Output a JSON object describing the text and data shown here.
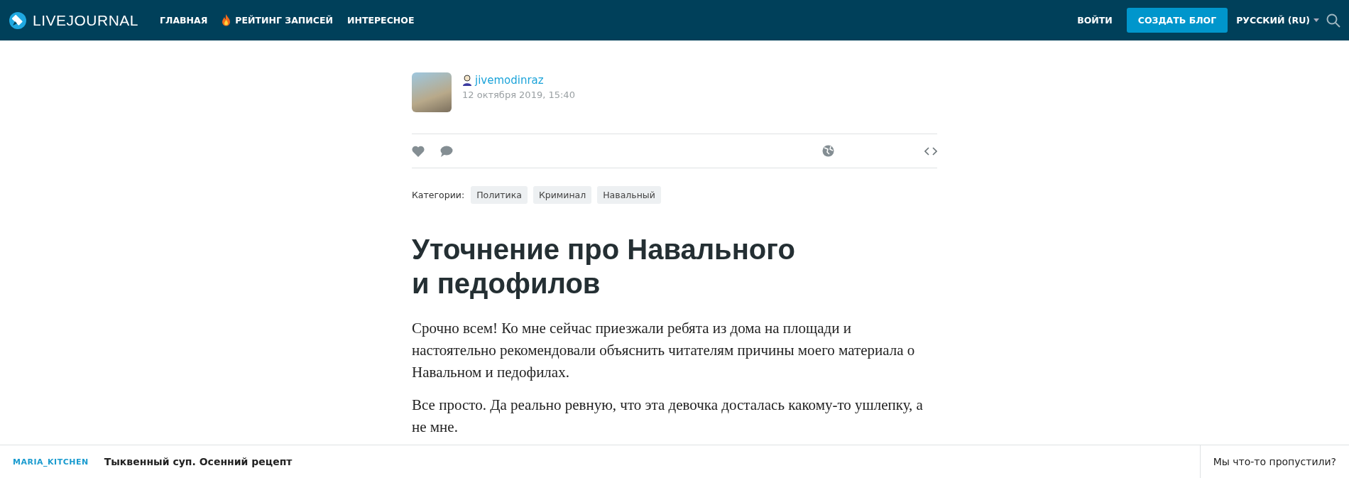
{
  "header": {
    "logo": "LIVEJOURNAL",
    "nav": [
      {
        "label": "ГЛАВНАЯ",
        "kind": "plain"
      },
      {
        "label": "РЕЙТИНГ ЗАПИСЕЙ",
        "kind": "fire"
      },
      {
        "label": "ИНТЕРЕСНОЕ",
        "kind": "plain"
      }
    ],
    "login": "ВОЙТИ",
    "create": "СОЗДАТЬ БЛОГ",
    "language": "РУССКИЙ (RU)"
  },
  "post": {
    "author": "jivemodinraz",
    "date": "12 октября 2019, 15:40",
    "categories_label": "Категории:",
    "categories": [
      "Политика",
      "Криминал",
      "Навальный"
    ],
    "title": "Уточнение про Навального и педофилов",
    "paragraphs": [
      "Срочно всем! Ко мне сейчас приезжали ребята из дома на площади и настоятельно рекомендовали объяснить читателям причины моего материала о Навальном и педофилах.",
      "Все просто. Да реально ревную, что эта девочка досталась какому-то ушлепку, а не мне."
    ]
  },
  "footer": {
    "user": "MARIA_KITCHEN",
    "headline": "Тыквенный суп. Осенний рецепт",
    "feedback": "Мы что-то пропустили?"
  }
}
